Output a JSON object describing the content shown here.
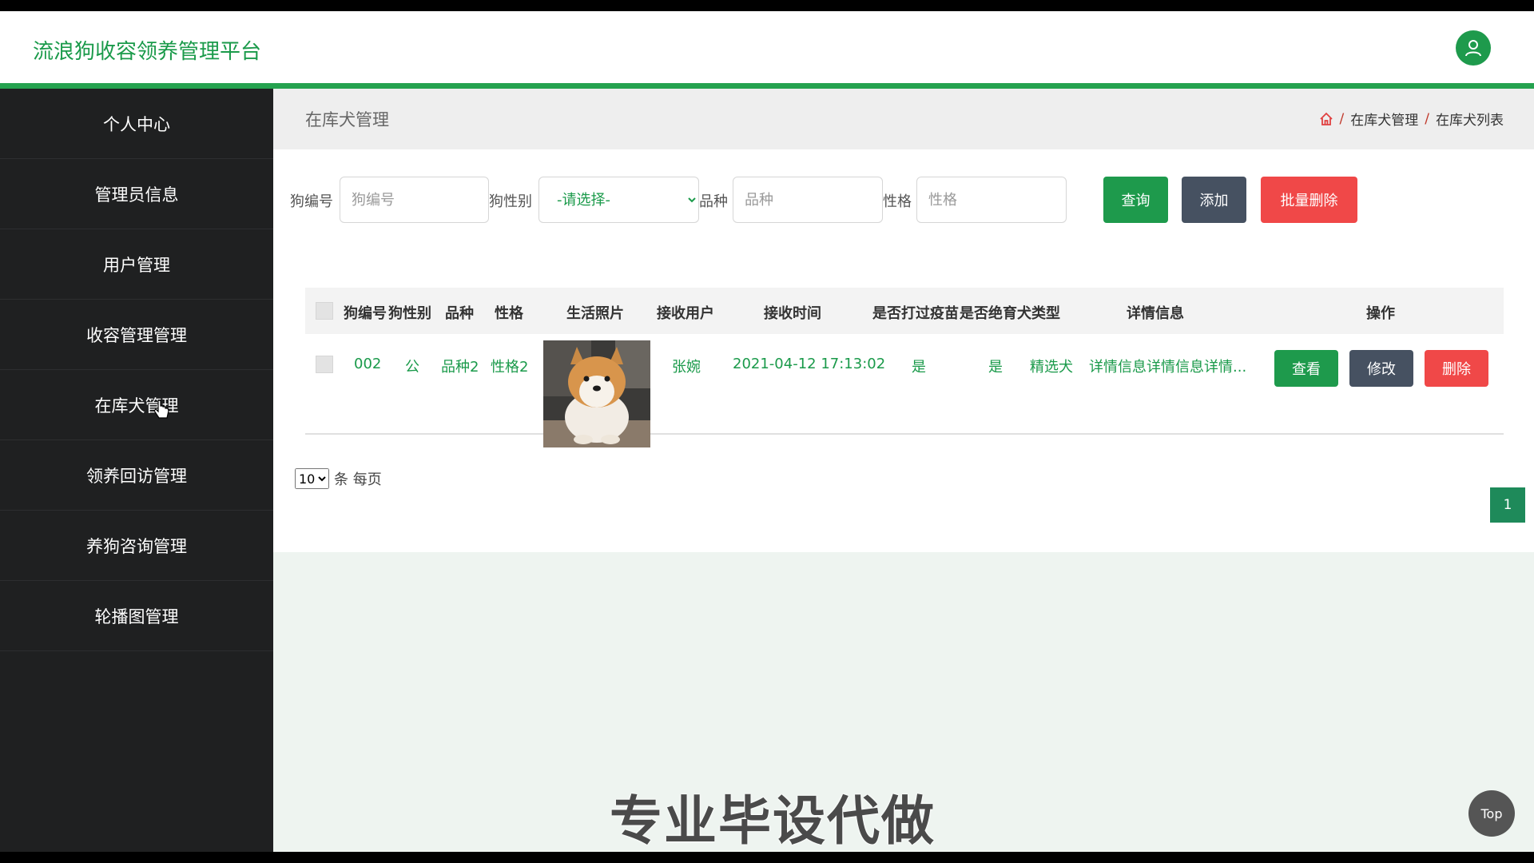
{
  "header": {
    "app_title": "流浪狗收容领养管理平台",
    "avatar_icon": "user-icon"
  },
  "sidebar": {
    "items": [
      {
        "label": "个人中心"
      },
      {
        "label": "管理员信息"
      },
      {
        "label": "用户管理"
      },
      {
        "label": "收容管理管理"
      },
      {
        "label": "在库犬管理"
      },
      {
        "label": "领养回访管理"
      },
      {
        "label": "养狗咨询管理"
      },
      {
        "label": "轮播图管理"
      }
    ]
  },
  "page": {
    "heading": "在库犬管理",
    "breadcrumb": [
      "在库犬管理",
      "在库犬列表"
    ],
    "breadcrumb_sep": "/"
  },
  "filters": {
    "dog_id_label": "狗编号",
    "dog_id_placeholder": "狗编号",
    "gender_label": "狗性别",
    "gender_selected": "-请选择-",
    "breed_label": "品种",
    "breed_placeholder": "品种",
    "temper_label": "性格",
    "temper_placeholder": "性格",
    "search_label": "查询",
    "add_label": "添加",
    "batch_delete_label": "批量删除"
  },
  "table": {
    "columns": [
      "狗编号",
      "狗性别",
      "品种",
      "性格",
      "生活照片",
      "接收用户",
      "接收时间",
      "是否打过疫苗",
      "是否绝育",
      "犬类型",
      "详情信息",
      "操作"
    ],
    "rows": [
      {
        "dog_id": "002",
        "gender": "公",
        "breed": "品种2",
        "temper": "性格2",
        "receiver": "张婉",
        "receive_time": "2021-04-12 17:13:02",
        "vaccinated": "是",
        "neutered": "是",
        "type": "精选犬",
        "details": "详情信息详情信息详情...",
        "view_label": "查看",
        "edit_label": "修改",
        "delete_label": "删除"
      }
    ]
  },
  "pagination": {
    "page_size": "10",
    "per_page_text": "条 每页",
    "current_page": "1"
  },
  "overlay": {
    "watermark": "专业毕设代做",
    "top_button": "Top"
  },
  "colors": {
    "accent": "#1e9a4c",
    "dark": "#465161",
    "danger": "#f04848",
    "sidebar": "#1f2021"
  }
}
